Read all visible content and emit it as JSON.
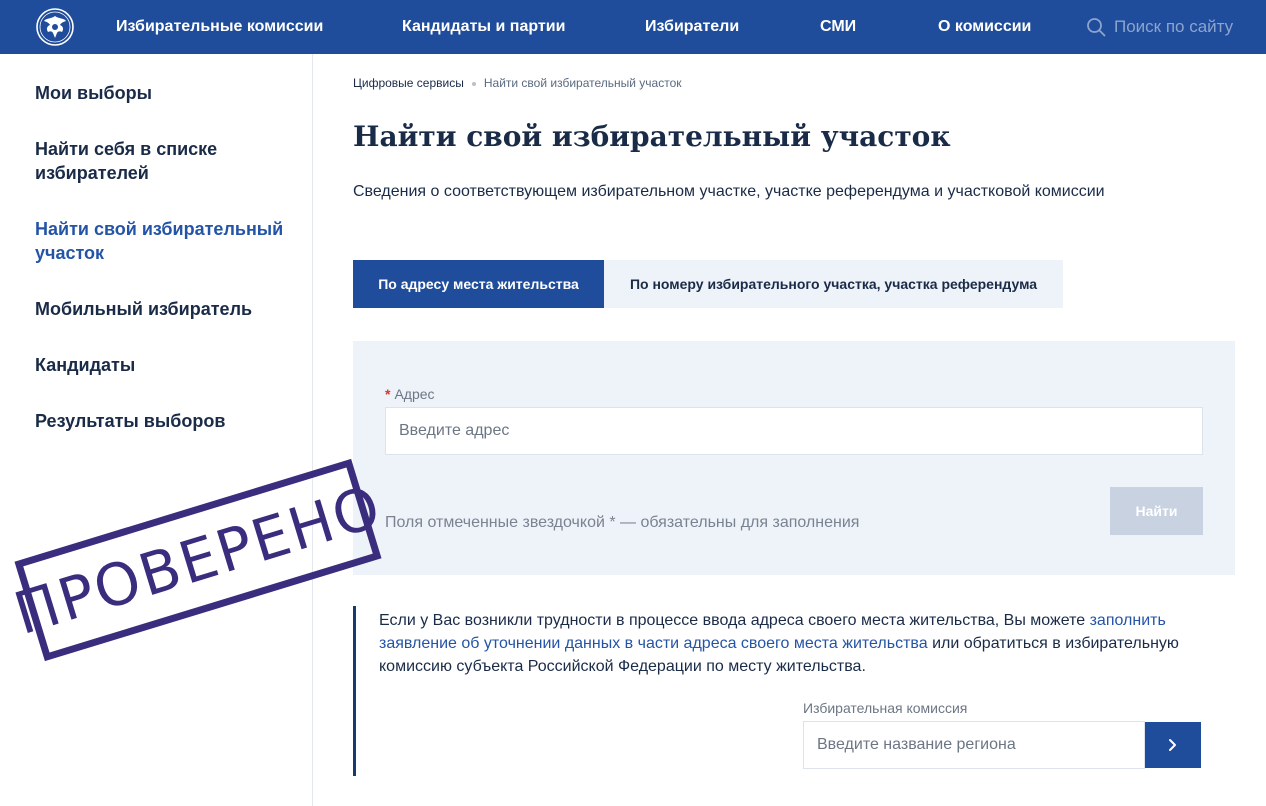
{
  "header": {
    "logo_icon": "russia-emblem-icon",
    "nav": [
      "Избирательные комиссии",
      "Кандидаты и партии",
      "Избиратели",
      "СМИ",
      "О комиссии"
    ],
    "search_placeholder": "Поиск по сайту",
    "bg_color": "#1f4d9b"
  },
  "sidebar": {
    "items": [
      "Мои выборы",
      "Найти себя в списке избирателей",
      "Найти свой избирательный участок",
      "Мобильный избиратель",
      "Кандидаты",
      "Результаты выборов"
    ],
    "active_index": 2
  },
  "breadcrumb": {
    "items": [
      "Цифровые сервисы",
      "Найти свой избирательный участок"
    ]
  },
  "main": {
    "title": "Найти свой избирательный участок",
    "subtitle": "Сведения о соответствующем избирательном участке, участке референдума и участковой комиссии",
    "tabs": [
      {
        "label": "По адресу места жительства",
        "active": true
      },
      {
        "label": "По номеру избирательного участка, участка референдума",
        "active": false
      }
    ],
    "form": {
      "required_mark": "*",
      "address_label": "Адрес",
      "address_placeholder": "Введите адрес",
      "address_value": "",
      "hint": "Поля отмеченные звездочкой * — обязательны для заполнения",
      "find_button": "Найти"
    },
    "note": {
      "text_before": "Если у Вас возникли трудности в процессе ввода адреса своего места жительства, Вы можете ",
      "link": "заполнить заявление об уточнении данных в части адреса своего места жительства",
      "text_after": " или обратиться в избирательную комиссию субъекта Российской Федерации по месту жительства."
    },
    "commission": {
      "label": "Избирательная комиссия",
      "placeholder": "Введите название региона",
      "go_icon": "chevron-right-icon"
    }
  },
  "stamp": {
    "text": "ПРОВЕРЕНО",
    "color": "#3b2d7e"
  }
}
